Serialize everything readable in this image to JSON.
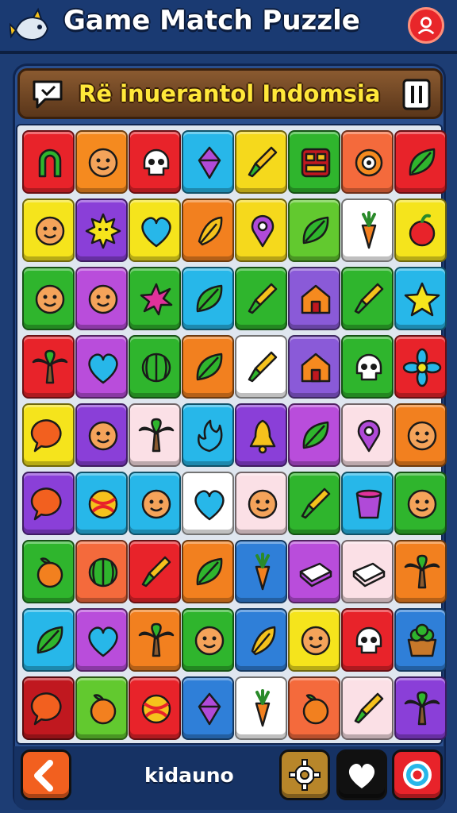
{
  "header": {
    "title": "Game Match Puzzle",
    "logo_icon": "fish-mascot-icon",
    "profile_icon": "profile-icon"
  },
  "banner": {
    "text": "Rë inuerantol Indomsia",
    "left_icon": "chat-bubble-icon",
    "right_icon": "pause-icon"
  },
  "board": {
    "rows": 9,
    "columns": 8,
    "tiles": [
      [
        {
          "bg": "#e8232a",
          "icon": "horseshoe-icon"
        },
        {
          "bg": "#f58a1f",
          "icon": "face-icon"
        },
        {
          "bg": "#e8232a",
          "icon": "skull-icon"
        },
        {
          "bg": "#27b7e9",
          "icon": "gem-icon"
        },
        {
          "bg": "#f5d91c",
          "icon": "brush-icon"
        },
        {
          "bg": "#2fb52d",
          "icon": "grid-box-icon"
        },
        {
          "bg": "#f46a3c",
          "icon": "target-icon"
        },
        {
          "bg": "#e8232a",
          "icon": "leaf-icon"
        }
      ],
      [
        {
          "bg": "#f5e41c",
          "icon": "face-icon"
        },
        {
          "bg": "#8a3fd8",
          "icon": "sun-icon"
        },
        {
          "bg": "#f5e41c",
          "icon": "heart-icon"
        },
        {
          "bg": "#f2801f",
          "icon": "feather-icon"
        },
        {
          "bg": "#f5d91c",
          "icon": "pin-icon"
        },
        {
          "bg": "#62c92f",
          "icon": "leaf-icon"
        },
        {
          "bg": "#ffffff",
          "icon": "carrot-icon"
        },
        {
          "bg": "#f5e41c",
          "icon": "apple-icon"
        }
      ],
      [
        {
          "bg": "#2fb52d",
          "icon": "face-icon"
        },
        {
          "bg": "#b94ddb",
          "icon": "face-icon"
        },
        {
          "bg": "#2fb52d",
          "icon": "splash-icon"
        },
        {
          "bg": "#27b7e9",
          "icon": "leaf-icon"
        },
        {
          "bg": "#2fb52d",
          "icon": "brush-icon"
        },
        {
          "bg": "#8a5ad8",
          "icon": "house-icon"
        },
        {
          "bg": "#2fb52d",
          "icon": "brush-icon"
        },
        {
          "bg": "#27b7e9",
          "icon": "star-icon"
        }
      ],
      [
        {
          "bg": "#e8232a",
          "icon": "palm-tree-icon"
        },
        {
          "bg": "#b94ddb",
          "icon": "heart-icon"
        },
        {
          "bg": "#2fb52d",
          "icon": "melon-icon"
        },
        {
          "bg": "#f2801f",
          "icon": "leaf-icon"
        },
        {
          "bg": "#ffffff",
          "icon": "brush-icon"
        },
        {
          "bg": "#8a5ad8",
          "icon": "house-icon"
        },
        {
          "bg": "#2fb52d",
          "icon": "skull-icon"
        },
        {
          "bg": "#e8232a",
          "icon": "flower-icon"
        }
      ],
      [
        {
          "bg": "#f5e41c",
          "icon": "chat-icon"
        },
        {
          "bg": "#8a3fd8",
          "icon": "face-icon"
        },
        {
          "bg": "#fbe0e6",
          "icon": "palm-tree-icon"
        },
        {
          "bg": "#27b7e9",
          "icon": "flame-icon"
        },
        {
          "bg": "#8a3fd8",
          "icon": "bell-icon"
        },
        {
          "bg": "#b94ddb",
          "icon": "leaf-icon"
        },
        {
          "bg": "#fbe0e6",
          "icon": "pin-icon"
        },
        {
          "bg": "#f2801f",
          "icon": "face-icon"
        }
      ],
      [
        {
          "bg": "#8a3fd8",
          "icon": "chat-icon"
        },
        {
          "bg": "#27b7e9",
          "icon": "ball-icon"
        },
        {
          "bg": "#27b7e9",
          "icon": "face-icon"
        },
        {
          "bg": "#ffffff",
          "icon": "heart-icon"
        },
        {
          "bg": "#fbe0e6",
          "icon": "face-icon"
        },
        {
          "bg": "#2fb52d",
          "icon": "brush-icon"
        },
        {
          "bg": "#27b7e9",
          "icon": "cup-icon"
        },
        {
          "bg": "#2fb52d",
          "icon": "face-icon"
        }
      ],
      [
        {
          "bg": "#2fb52d",
          "icon": "fruit-icon"
        },
        {
          "bg": "#f46a3c",
          "icon": "melon-icon"
        },
        {
          "bg": "#e8232a",
          "icon": "brush-icon"
        },
        {
          "bg": "#f2801f",
          "icon": "leaf-icon"
        },
        {
          "bg": "#2f7fd8",
          "icon": "carrot-icon"
        },
        {
          "bg": "#b94ddb",
          "icon": "book-icon"
        },
        {
          "bg": "#fbe0e6",
          "icon": "book-icon"
        },
        {
          "bg": "#f2801f",
          "icon": "palm-tree-icon"
        }
      ],
      [
        {
          "bg": "#27b7e9",
          "icon": "leaf-icon"
        },
        {
          "bg": "#b94ddb",
          "icon": "heart-icon"
        },
        {
          "bg": "#f2801f",
          "icon": "palm-tree-icon"
        },
        {
          "bg": "#2fb52d",
          "icon": "face-icon"
        },
        {
          "bg": "#2f7fd8",
          "icon": "feather-icon"
        },
        {
          "bg": "#f5e41c",
          "icon": "face-icon"
        },
        {
          "bg": "#e8232a",
          "icon": "skull-icon"
        },
        {
          "bg": "#2f7fd8",
          "icon": "basket-icon"
        }
      ],
      [
        {
          "bg": "#c0181f",
          "icon": "chat-icon"
        },
        {
          "bg": "#62c92f",
          "icon": "fruit-icon"
        },
        {
          "bg": "#e8232a",
          "icon": "ball-icon"
        },
        {
          "bg": "#2f7fd8",
          "icon": "gem-icon"
        },
        {
          "bg": "#ffffff",
          "icon": "carrot-icon"
        },
        {
          "bg": "#f46a3c",
          "icon": "fruit-icon"
        },
        {
          "bg": "#fbe0e6",
          "icon": "brush-icon"
        },
        {
          "bg": "#8a3fd8",
          "icon": "palm-tree-icon"
        }
      ]
    ]
  },
  "bottom_bar": {
    "back_icon": "back-arrow-icon",
    "player_name": "kidauno",
    "settings_icon": "gear-icon",
    "like_icon": "heart-icon",
    "hint_icon": "lifebuoy-icon"
  }
}
